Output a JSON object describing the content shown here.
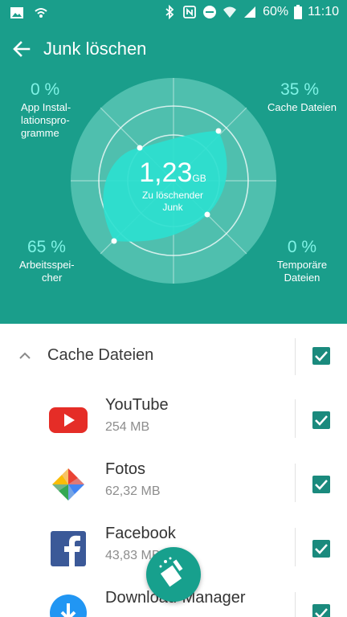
{
  "status_bar": {
    "icons": [
      "image-icon",
      "wifi-hotspot-icon",
      "bluetooth-icon",
      "nfc-icon",
      "do-not-disturb-icon",
      "wifi-icon",
      "signal-icon",
      "battery-icon"
    ],
    "battery": "60%",
    "time": "11:10"
  },
  "app_bar": {
    "title": "Junk löschen",
    "back_icon": "arrow-back-icon"
  },
  "radar": {
    "center_value": "1,23",
    "center_unit": "GB",
    "center_label_line1": "Zu löschender",
    "center_label_line2": "Junk",
    "accent": "#7ff3e6",
    "quadrants": {
      "top_left": {
        "pct": "0 %",
        "label_line1": "App Instal-",
        "label_line2": "lationspro-",
        "label_line3": "gramme"
      },
      "top_right": {
        "pct": "35 %",
        "label_line1": "Cache Dateien"
      },
      "bottom_left": {
        "pct": "65 %",
        "label_line1": "Arbeitsspei-",
        "label_line2": "cher"
      },
      "bottom_right": {
        "pct": "0 %",
        "label_line1": "Temporäre",
        "label_line2": "Dateien"
      }
    }
  },
  "list": {
    "group": {
      "label": "Cache Dateien",
      "checked": true
    },
    "items": [
      {
        "name": "YouTube",
        "size": "254 MB",
        "icon": "youtube-icon",
        "checked": true
      },
      {
        "name": "Fotos",
        "size": "62,32 MB",
        "icon": "photos-icon",
        "checked": true
      },
      {
        "name": "Facebook",
        "size": "43,83 MB",
        "icon": "facebook-icon",
        "checked": true
      },
      {
        "name": "Download-Manager",
        "size": "",
        "icon": "download-icon",
        "checked": true
      }
    ]
  },
  "fab": {
    "icon": "broom-icon"
  },
  "colors": {
    "header": "#1a9e8b",
    "checkbox": "#1a8a7d",
    "fab": "#17a08d"
  }
}
